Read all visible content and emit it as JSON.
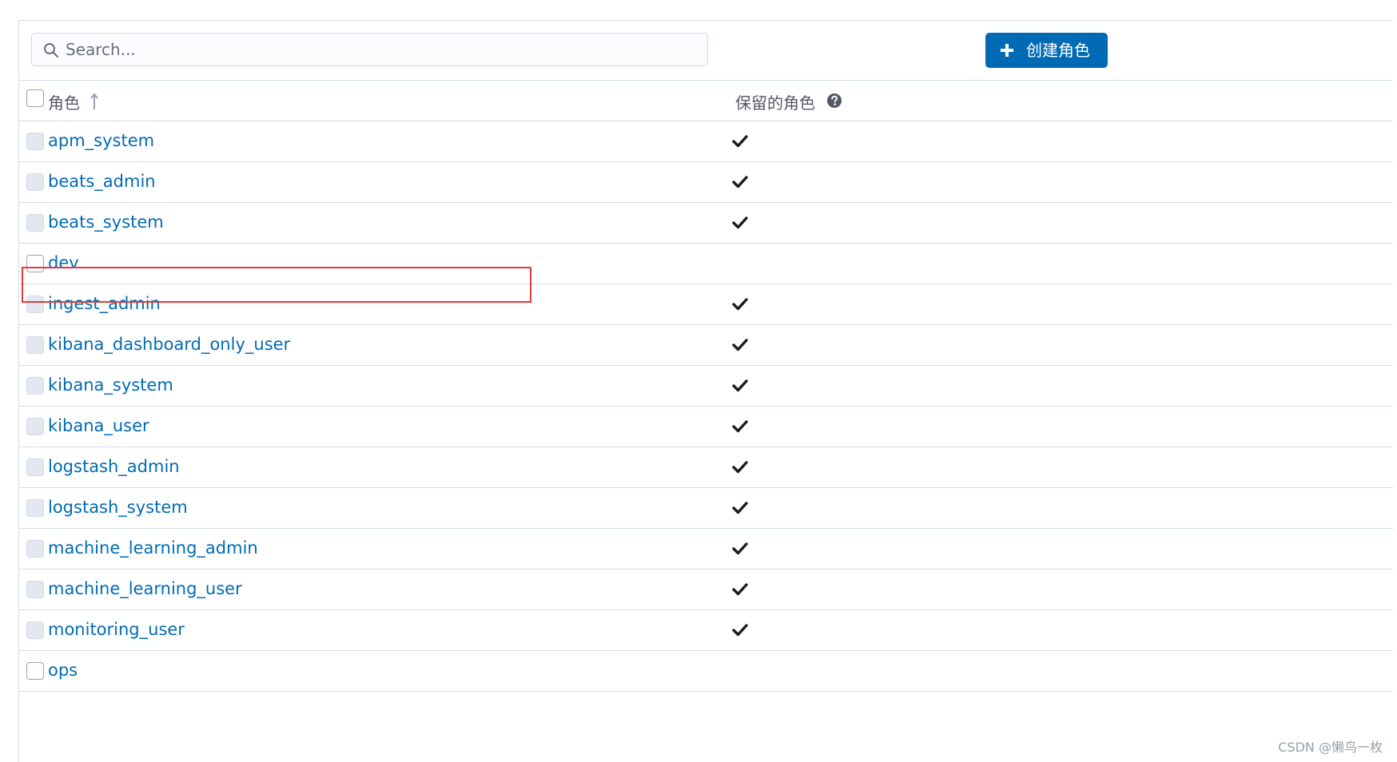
{
  "search": {
    "placeholder": "Search..."
  },
  "toolbar": {
    "create_label": "创建角色"
  },
  "table": {
    "columns": [
      "角色",
      "保留的角色"
    ],
    "rows": [
      {
        "role": "apm_system",
        "reserved": true
      },
      {
        "role": "beats_admin",
        "reserved": true
      },
      {
        "role": "beats_system",
        "reserved": true
      },
      {
        "role": "dev",
        "reserved": false
      },
      {
        "role": "ingest_admin",
        "reserved": true
      },
      {
        "role": "kibana_dashboard_only_user",
        "reserved": true
      },
      {
        "role": "kibana_system",
        "reserved": true
      },
      {
        "role": "kibana_user",
        "reserved": true
      },
      {
        "role": "logstash_admin",
        "reserved": true
      },
      {
        "role": "logstash_system",
        "reserved": true
      },
      {
        "role": "machine_learning_admin",
        "reserved": true
      },
      {
        "role": "machine_learning_user",
        "reserved": true
      },
      {
        "role": "monitoring_user",
        "reserved": true
      },
      {
        "role": "ops",
        "reserved": false
      }
    ]
  },
  "watermark": "CSDN @懒鸟一枚",
  "colors": {
    "primary": "#006bb4",
    "link": "#006bb4",
    "border": "#d3dae6",
    "highlight": "#e53935"
  }
}
